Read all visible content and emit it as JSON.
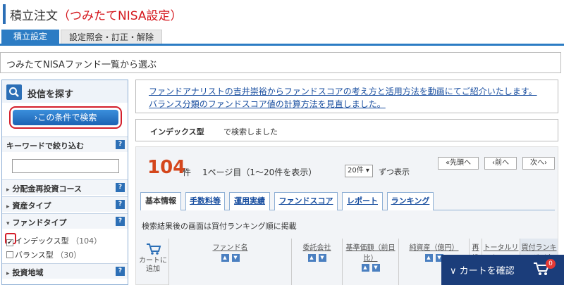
{
  "header": {
    "title_main": "積立注文",
    "title_sub": "（つみたてNISA設定）"
  },
  "tabs": [
    {
      "label": "積立設定"
    },
    {
      "label": "設定照会・訂正・解除"
    }
  ],
  "section_title": "つみたてNISAファンド一覧から選ぶ",
  "sidebar": {
    "title": "投信を探す",
    "search_button": "›この条件で検索",
    "keyword_label": "キーワードで絞り込む",
    "keyword_value": "",
    "rows": [
      {
        "label": "分配金再投資コース",
        "arrow": "▸"
      },
      {
        "label": "資産タイプ",
        "arrow": "▸"
      },
      {
        "label": "ファンドタイプ",
        "arrow": "▾"
      }
    ],
    "checks": [
      {
        "label": "インデックス型",
        "count": "（104）",
        "checked": true
      },
      {
        "label": "バランス型",
        "count": "（30）",
        "checked": false
      }
    ],
    "region_label": "投資地域",
    "help": "?"
  },
  "notice": {
    "link1": "ファンドアナリストの吉井崇裕からファンドスコアの考え方と活用方法を動画にてご紹介いたします。",
    "link2": "バランス分類のファンドスコア値の計算方法を見直しました。"
  },
  "result": {
    "key": "インデックス型",
    "value": "で検索しました"
  },
  "results": {
    "count": "104",
    "count_unit": "件",
    "page_info": "1ページ目（1～20件を表示）",
    "per_page": "20件 ▾",
    "per_page_suffix": "ずつ表示",
    "pager": {
      "first": "«先頭へ",
      "prev": "‹前へ",
      "next": "次へ›"
    },
    "subtabs": [
      "基本情報",
      "手数料等",
      "運用実績",
      "ファンドスコア",
      "レポート",
      "ランキング"
    ],
    "note": "検索結果後の画面は買付ランキング順に掲載",
    "cart_col": "カートに追加",
    "columns": [
      "ファンド名",
      "委託会社",
      "基準価額（前日比）",
      "純資産（億円）",
      "再投",
      "トータルリターン",
      "買付ランキング（全体）"
    ]
  },
  "cart_bar": {
    "label": "∨ カートを確認",
    "badge": "0"
  },
  "colors": {
    "accent": "#2c7cc4",
    "red": "#d41e2a",
    "navy": "#1b3d7a"
  }
}
